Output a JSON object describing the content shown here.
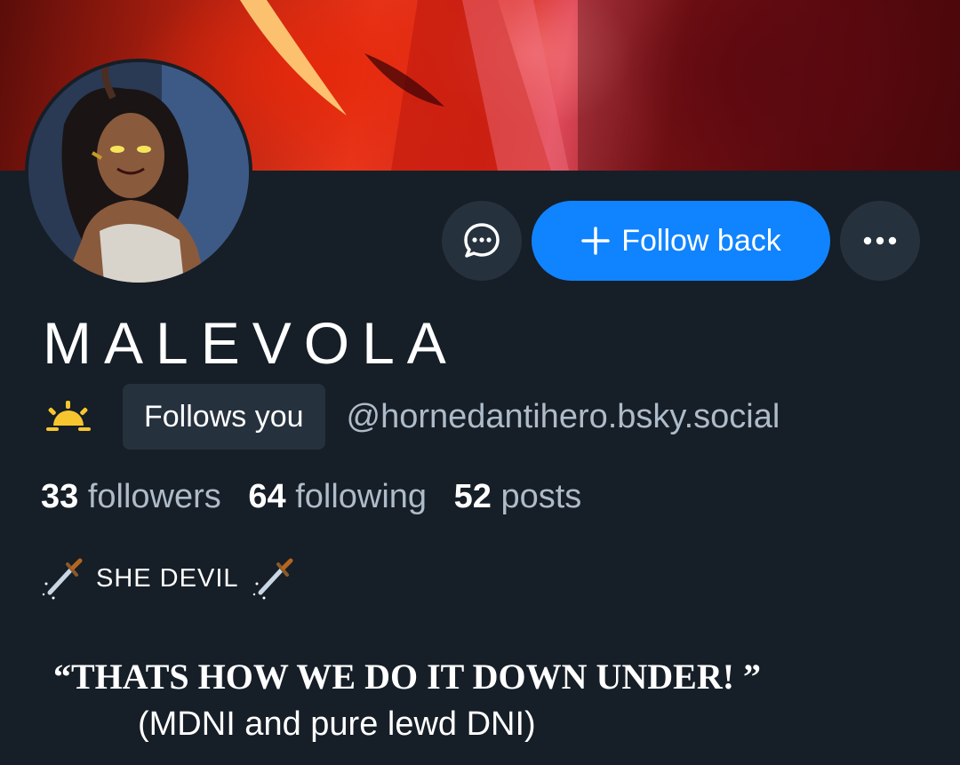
{
  "profile": {
    "display_name": "MALEVOLA",
    "handle": "@hornedantihero.bsky.social",
    "follows_you_label": "Follows you",
    "sun_icon": "sunrise-emoji-icon"
  },
  "actions": {
    "follow_back_label": "Follow back",
    "message_icon": "chat-bubble-icon",
    "more_icon": "ellipsis-icon"
  },
  "stats": {
    "followers_count": "33",
    "followers_label": "followers",
    "following_count": "64",
    "following_label": "following",
    "posts_count": "52",
    "posts_label": "posts"
  },
  "bio": {
    "line1": "SHE DEVIL",
    "line1_icon": "dagger-emoji-icon",
    "line2": "“THATS HOW WE DO IT DOWN UNDER! ”",
    "line3": "(MDNI and pure lewd DNI)"
  },
  "colors": {
    "background": "#161e27",
    "button_secondary": "#26313e",
    "accent_blue": "#1083fe",
    "muted_text": "#aebbc9"
  }
}
